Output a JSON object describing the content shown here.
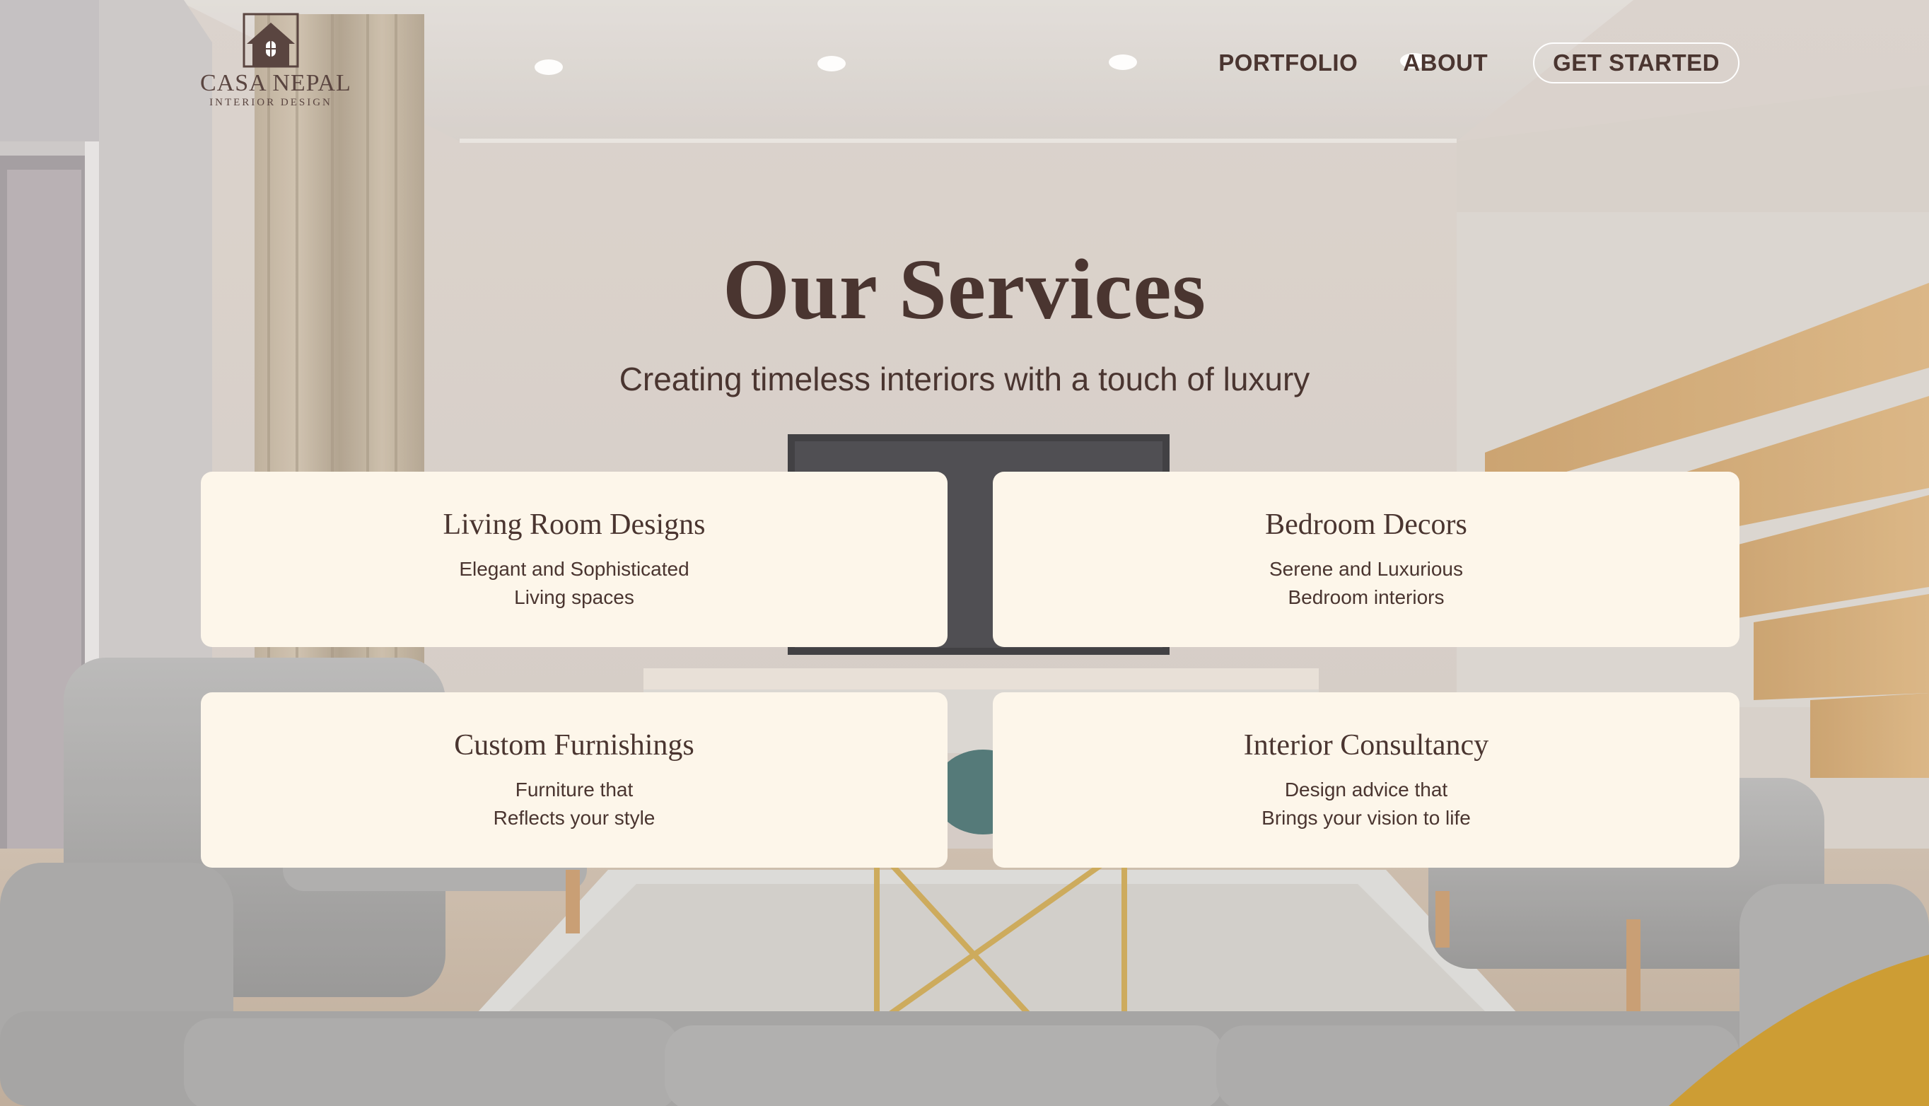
{
  "brand": {
    "name": "CASA NEPAL",
    "tagline": "INTERIOR DESIGN"
  },
  "nav": {
    "portfolio": "PORTFOLIO",
    "about": "ABOUT",
    "cta": "GET STARTED"
  },
  "hero": {
    "title": "Our Services",
    "subtitle": "Creating timeless interiors with a touch of luxury"
  },
  "services": [
    {
      "title": "Living Room Designs",
      "line1": "Elegant and Sophisticated",
      "line2": "Living spaces"
    },
    {
      "title": "Bedroom Decors",
      "line1": "Serene and Luxurious",
      "line2": "Bedroom interiors"
    },
    {
      "title": "Custom Furnishings",
      "line1": "Furniture that",
      "line2": "Reflects your style"
    },
    {
      "title": "Interior Consultancy",
      "line1": "Design advice that",
      "line2": "Brings your vision to life"
    }
  ],
  "colors": {
    "text": "#4a3530",
    "card_bg": "#fdf6ea",
    "logo": "#5a4540",
    "accent_mustard": "#c8921c"
  },
  "icons": {
    "logo": "house-logo-icon"
  }
}
